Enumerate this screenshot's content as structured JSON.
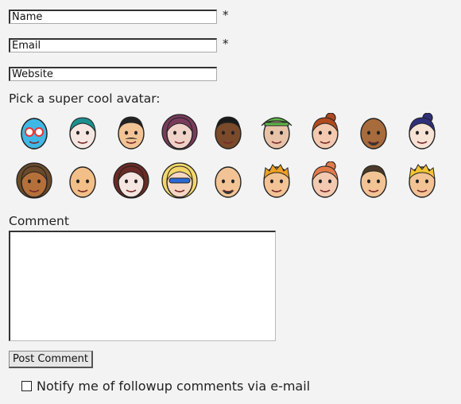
{
  "form": {
    "name_value": "Name",
    "email_value": "Email",
    "website_value": "Website",
    "required_marker": "*",
    "avatar_heading": "Pick a super cool avatar:",
    "comment_label": "Comment",
    "submit_label": "Post Comment",
    "notify_label": "Notify me of followup comments via e-mail"
  },
  "avatars": [
    {
      "name": "luchador-mask",
      "skin": "#3fb8e6",
      "hair": "#3fb8e6",
      "style": "mask"
    },
    {
      "name": "teal-hair-pale",
      "skin": "#f5e6e1",
      "hair": "#1e8f8f",
      "style": "side"
    },
    {
      "name": "mustache-man",
      "skin": "#f2c394",
      "hair": "#222222",
      "style": "short"
    },
    {
      "name": "dreadlocks-pink",
      "skin": "#f0d2c8",
      "hair": "#7a3b5b",
      "style": "dreads"
    },
    {
      "name": "dark-skin-man",
      "skin": "#7a4a2a",
      "hair": "#1a1a1a",
      "style": "short"
    },
    {
      "name": "green-hat",
      "skin": "#e8c3a8",
      "hair": "#5fb84a",
      "style": "hat"
    },
    {
      "name": "red-hair-bun",
      "skin": "#f3c9b0",
      "hair": "#b04a1e",
      "style": "bun"
    },
    {
      "name": "bald-beard-dark",
      "skin": "#a86b3c",
      "hair": "#555555",
      "style": "bald"
    },
    {
      "name": "blue-hair-bun",
      "skin": "#f7e3d6",
      "hair": "#2f2f7a",
      "style": "bun"
    },
    {
      "name": "curly-laugh",
      "skin": "#b5703a",
      "hair": "#6b4a2a",
      "style": "curly"
    },
    {
      "name": "bald-smile",
      "skin": "#f2bf88",
      "hair": "#2a1a0a",
      "style": "bald"
    },
    {
      "name": "dark-hood",
      "skin": "#f5e6e1",
      "hair": "#6b2a24",
      "style": "hood"
    },
    {
      "name": "blonde-glasses",
      "skin": "#f6d7c3",
      "hair": "#f3d76a",
      "style": "long"
    },
    {
      "name": "bald-goatee",
      "skin": "#f2c394",
      "hair": "#555555",
      "style": "bald"
    },
    {
      "name": "spiky-orange",
      "skin": "#f2c394",
      "hair": "#f0a020",
      "style": "spiky"
    },
    {
      "name": "red-hair-woman",
      "skin": "#f3c9b0",
      "hair": "#e27a4a",
      "style": "bun"
    },
    {
      "name": "buzzcut-man",
      "skin": "#f2c394",
      "hair": "#4a3a2a",
      "style": "short"
    },
    {
      "name": "yellow-hair",
      "skin": "#f2c394",
      "hair": "#f4c430",
      "style": "spiky"
    }
  ]
}
